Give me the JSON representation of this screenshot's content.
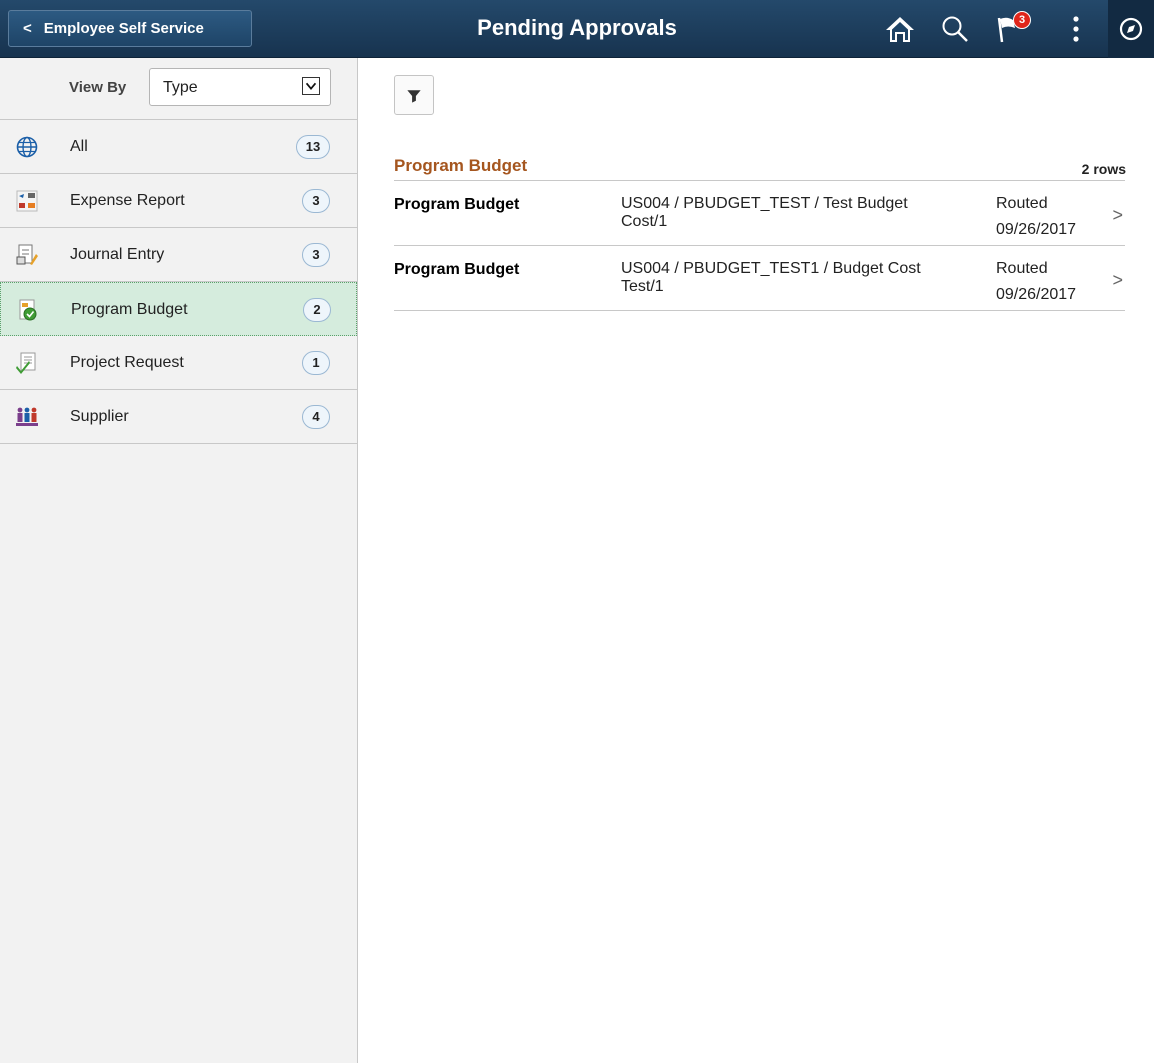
{
  "header": {
    "back_label": "Employee Self Service",
    "title": "Pending Approvals",
    "notification_count": "3",
    "icons": [
      "home-icon",
      "search-icon",
      "flag-icon",
      "kebab-icon",
      "compass-icon"
    ]
  },
  "sidebar": {
    "view_by_label": "View By",
    "view_by_value": "Type",
    "items": [
      {
        "label": "All",
        "count": "13",
        "icon": "globe-icon"
      },
      {
        "label": "Expense Report",
        "count": "3",
        "icon": "expense-icon"
      },
      {
        "label": "Journal Entry",
        "count": "3",
        "icon": "journal-icon"
      },
      {
        "label": "Program Budget",
        "count": "2",
        "icon": "budget-icon",
        "selected": true
      },
      {
        "label": "Project Request",
        "count": "1",
        "icon": "project-icon"
      },
      {
        "label": "Supplier",
        "count": "4",
        "icon": "supplier-icon"
      }
    ]
  },
  "main": {
    "section_title": "Program Budget",
    "rows_label": "2 rows",
    "rows": [
      {
        "type": "Program Budget",
        "description": "US004 / PBUDGET_TEST / Test Budget Cost/1",
        "status": "Routed",
        "date": "09/26/2017"
      },
      {
        "type": "Program Budget",
        "description": "US004 / PBUDGET_TEST1 / Budget Cost Test/1",
        "status": "Routed",
        "date": "09/26/2017"
      }
    ]
  },
  "colors": {
    "header_bg": "#1e4467",
    "section_title": "#a5561f",
    "selected_bg": "#d5ecdd",
    "badge": "#e0261b"
  }
}
